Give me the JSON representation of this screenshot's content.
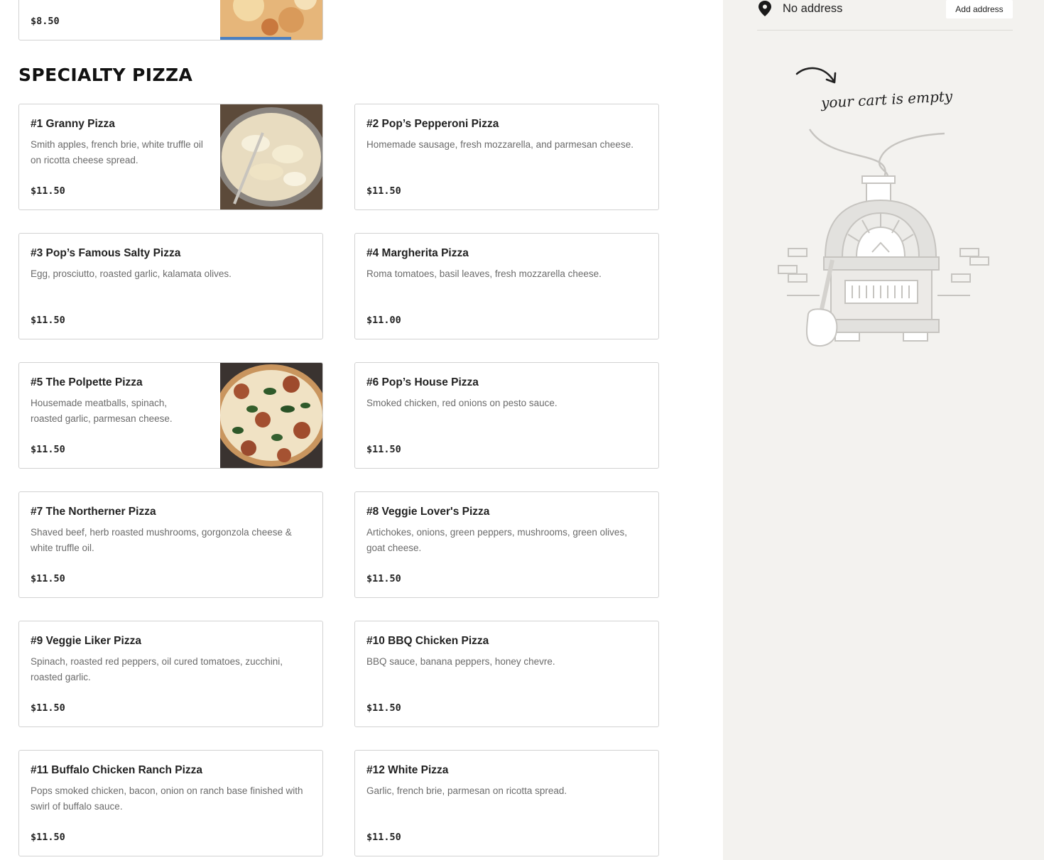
{
  "menu": {
    "previous_item": {
      "price": "$8.50"
    },
    "section_title": "SPECIALTY PIZZA",
    "items": [
      {
        "name": "#1 Granny Pizza",
        "desc": "Smith apples, french brie, white truffle oil on ricotta cheese spread.",
        "price": "$11.50"
      },
      {
        "name": "#2 Pop’s Pepperoni Pizza",
        "desc": "Homemade sausage, fresh mozzarella, and parmesan cheese.",
        "price": "$11.50"
      },
      {
        "name": "#3 Pop’s Famous Salty Pizza",
        "desc": "Egg, prosciutto, roasted garlic, kalamata olives.",
        "price": "$11.50"
      },
      {
        "name": "#4 Margherita Pizza",
        "desc": "Roma tomatoes, basil leaves, fresh mozzarella cheese.",
        "price": "$11.00"
      },
      {
        "name": "#5 The Polpette Pizza",
        "desc": "Housemade meatballs, spinach, roasted garlic, parmesan cheese.",
        "price": "$11.50"
      },
      {
        "name": "#6 Pop’s House Pizza",
        "desc": "Smoked chicken, red onions on pesto sauce.",
        "price": "$11.50"
      },
      {
        "name": "#7 The Northerner Pizza",
        "desc": "Shaved beef, herb roasted mushrooms, gorgonzola cheese & white truffle oil.",
        "price": "$11.50"
      },
      {
        "name": "#8 Veggie Lover's Pizza",
        "desc": "Artichokes, onions, green peppers, mushrooms, green olives, goat cheese.",
        "price": "$11.50"
      },
      {
        "name": "#9 Veggie Liker Pizza",
        "desc": "Spinach, roasted red peppers, oil cured tomatoes, zucchini, roasted garlic.",
        "price": "$11.50"
      },
      {
        "name": "#10 BBQ Chicken Pizza",
        "desc": "BBQ sauce, banana peppers, honey chevre.",
        "price": "$11.50"
      },
      {
        "name": "#11 Buffalo Chicken Ranch Pizza",
        "desc": "Pops smoked chicken, bacon, onion on ranch base finished with swirl of buffalo sauce.",
        "price": "$11.50"
      },
      {
        "name": "#12 White Pizza",
        "desc": "Garlic, french brie, parmesan on ricotta spread.",
        "price": "$11.50"
      }
    ]
  },
  "cart": {
    "address_text": "No address",
    "add_address_label": "Add address",
    "empty_text": "your cart is empty",
    "icons": {
      "location": "location-pin-icon",
      "illustration": "pizza-oven-illustration"
    }
  },
  "colors": {
    "sidebar_bg": "#f3f2ef",
    "card_border": "#d2d2d2",
    "desc_text": "#6b6b6b"
  }
}
